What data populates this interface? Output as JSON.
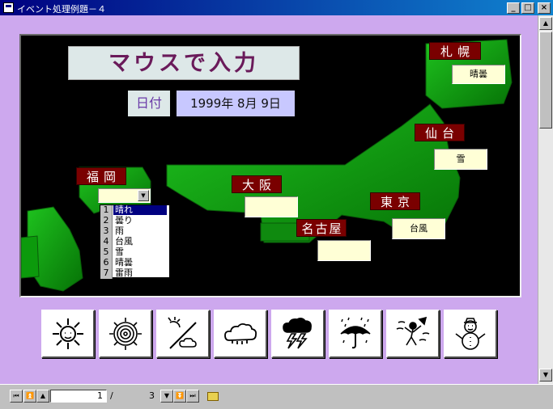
{
  "window": {
    "title": "イベント処理例題－４",
    "minimize_glyph": "_",
    "maximize_glyph": "□",
    "close_glyph": "×"
  },
  "form": {
    "heading": "マウスで入力",
    "date_label": "日付",
    "date_value": "1999年 8月 9日"
  },
  "cities": {
    "sapporo": {
      "name": "札幌",
      "weather": "晴曇"
    },
    "sendai": {
      "name": "仙台",
      "weather": "雪"
    },
    "tokyo": {
      "name": "東京",
      "weather": "台風"
    },
    "nagoya": {
      "name": "名古屋",
      "weather": ""
    },
    "osaka": {
      "name": "大阪",
      "weather": ""
    },
    "fukuoka": {
      "name": "福岡",
      "weather": ""
    }
  },
  "dropdown": {
    "options": [
      {
        "num": "1",
        "label": "晴れ",
        "selected": true
      },
      {
        "num": "2",
        "label": "曇り"
      },
      {
        "num": "3",
        "label": "雨"
      },
      {
        "num": "4",
        "label": "台風"
      },
      {
        "num": "5",
        "label": "雪"
      },
      {
        "num": "6",
        "label": "晴曇"
      },
      {
        "num": "7",
        "label": "雷雨"
      }
    ]
  },
  "weather_icons": [
    "sun-icon",
    "spiral-sun-icon",
    "sun-cloud-icon",
    "cloud-icon",
    "thunderstorm-icon",
    "umbrella-rain-icon",
    "typhoon-icon",
    "snowman-icon"
  ],
  "record_nav": {
    "current": "1",
    "separator": "/",
    "total": "3"
  },
  "colors": {
    "form_bg": "#cda8ee",
    "city_label": "#7a0000",
    "land": "#0a9a0a",
    "heading_text": "#6a1a5a"
  }
}
